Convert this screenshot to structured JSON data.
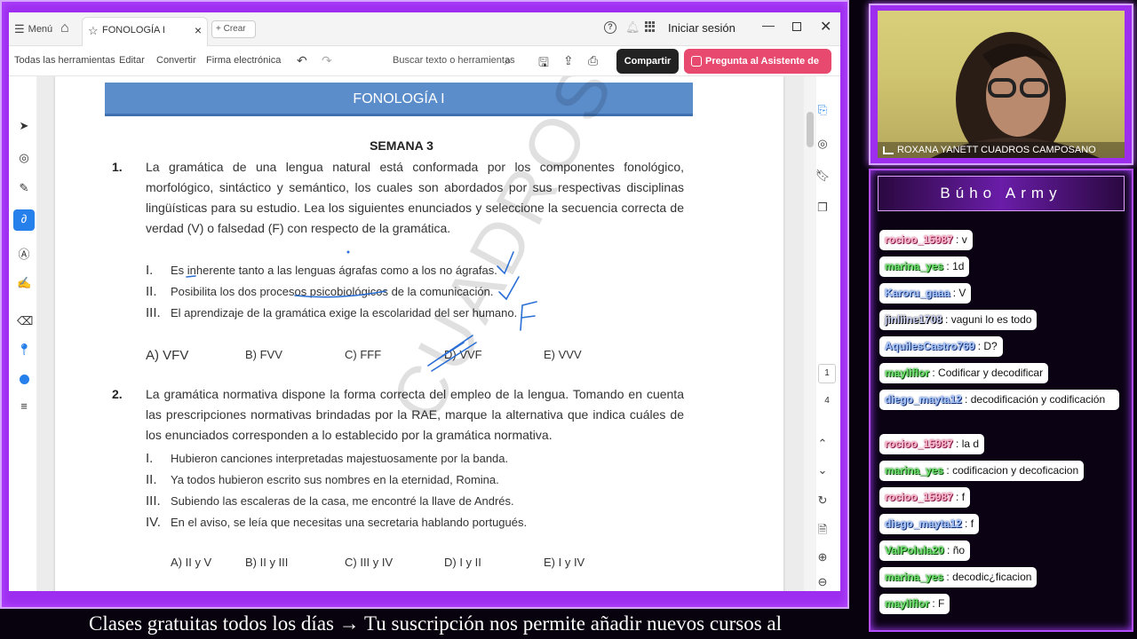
{
  "titlebar": {
    "menu_label": "Menú",
    "tab_label": "FONOLOGÍA I",
    "new_label": "Crear",
    "signin_label": "Iniciar sesión"
  },
  "toolbar": {
    "menus": [
      "Todas las herramientas",
      "Editar",
      "Convertir",
      "Firma electrónica"
    ],
    "search_placeholder": "Buscar texto o herramientas",
    "share_label": "Compartir",
    "ai_label": "Pregunta al Asistente de IA"
  },
  "document": {
    "banner_title": "FONOLOGÍA I",
    "week_label": "SEMANA 3",
    "q1": {
      "number": "1.",
      "text": "La gramática de una lengua natural está conformada por los componentes fonológico, morfológico, sintáctico y semántico, los cuales son abordados por sus respectivas disciplinas lingüísticas para su estudio. Lea los siguientes enunciados y seleccione la secuencia correcta de verdad (V) o falsedad (F) con respecto de la gramática.",
      "items": [
        {
          "roman": "I.",
          "text": "Es inherente tanto a las lenguas ágrafas como a los no ágrafas."
        },
        {
          "roman": "II.",
          "text": "Posibilita los dos procesos psicobiológicos de la comunicación."
        },
        {
          "roman": "III.",
          "text": "El aprendizaje de la gramática exige la escolaridad del ser humano."
        }
      ],
      "options": [
        "A) VFV",
        "B) FVV",
        "C) FFF",
        "D) VVF",
        "E) VVV"
      ]
    },
    "q2": {
      "number": "2.",
      "text": "La gramática normativa dispone la forma correcta del empleo de la lengua. Tomando en cuenta las prescripciones normativas brindadas por la RAE, marque la alternativa que indica cuáles de los enunciados corresponden a lo establecido por la gramática normativa.",
      "items": [
        {
          "roman": "I.",
          "text": "Hubieron canciones interpretadas majestuosamente por la banda."
        },
        {
          "roman": "II.",
          "text": "Ya todos hubieron escrito sus nombres en la eternidad, Romina."
        },
        {
          "roman": "III.",
          "text": "Subiendo las escaleras de la casa, me encontré la llave de Andrés."
        },
        {
          "roman": "IV.",
          "text": "En el aviso, se leía que necesitas una secretaria hablando portugués."
        }
      ],
      "options": [
        "A) II y V",
        "B) II y III",
        "C) III y IV",
        "D) I y II",
        "E) I y IV"
      ]
    },
    "watermark": "CUADROS"
  },
  "right_rail": {
    "page_current": "1",
    "page_total": "4"
  },
  "webcam": {
    "name": "ROXANA YANETT CUADROS CAMPOSANO"
  },
  "chat": {
    "title": "Búho Army",
    "messages": [
      {
        "user": "rocioo_15987",
        "text": "v",
        "color": "pink"
      },
      {
        "user": "marina_yes",
        "text": "1d",
        "color": "green"
      },
      {
        "user": "Karoru_gaaa",
        "text": "V",
        "color": "blue"
      },
      {
        "user": "jinliine1708",
        "text": "vaguni lo es todo",
        "color": "navy"
      },
      {
        "user": "AquilesCastro769",
        "text": "D?",
        "color": "blue"
      },
      {
        "user": "mayliflor",
        "text": "Codificar y decodificar",
        "color": "green"
      },
      {
        "user": "diego_mayta12",
        "text": "decodificación y codificación",
        "color": "blue"
      },
      {
        "user": "rocioo_15987",
        "text": "la d",
        "color": "pink"
      },
      {
        "user": "marina_yes",
        "text": "codificacion y decoficacion",
        "color": "green"
      },
      {
        "user": "rocioo_15987",
        "text": "f",
        "color": "pink"
      },
      {
        "user": "diego_mayta12",
        "text": "f",
        "color": "blue"
      },
      {
        "user": "ValPolula20",
        "text": "ño",
        "color": "green"
      },
      {
        "user": "marina_yes",
        "text": "decodic¿ficacion",
        "color": "green"
      },
      {
        "user": "mayliflor",
        "text": "F",
        "color": "green"
      }
    ]
  },
  "ticker": {
    "text": "Clases gratuitas todos los días  →  Tu suscripción nos permite añadir nuevos cursos al"
  },
  "colors": {
    "accent_purple": "#9d2ef0",
    "banner_blue": "#5b8dcb",
    "ai_button": "#e8496e",
    "ink_blue": "#2a6fd6"
  }
}
